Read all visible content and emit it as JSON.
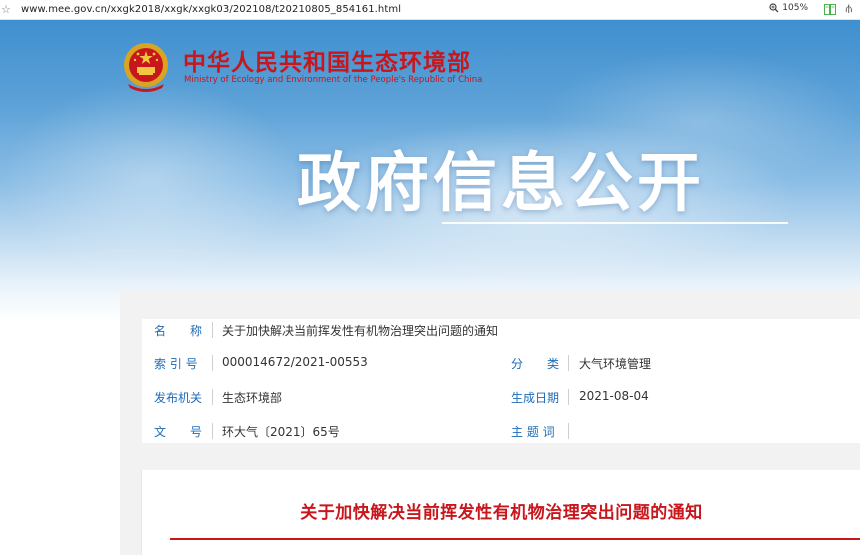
{
  "browser": {
    "url": "www.mee.gov.cn/xxgk2018/xxgk/xxgk03/202108/t20210805_854161.html",
    "zoom": "105%",
    "icons": [
      "bookmark-star-icon",
      "zoom-icon",
      "reader-mode-icon",
      "pin-icon"
    ]
  },
  "site": {
    "title": "中华人民共和国生态环境部",
    "subtitle": "Ministry of Ecology and Environment of the People's Republic of China"
  },
  "hero": {
    "title": "政府信息公开"
  },
  "info": {
    "name_label": "名　　称",
    "name_value": "关于加快解决当前挥发性有机物治理突出问题的通知",
    "index_label": "索 引 号",
    "index_value": "000014672/2021-00553",
    "category_label": "分　　类",
    "category_value": "大气环境管理",
    "issuer_label": "发布机关",
    "issuer_value": "生态环境部",
    "date_label": "生成日期",
    "date_value": "2021-08-04",
    "docno_label": "文　　号",
    "docno_value": "环大气〔2021〕65号",
    "subject_label": "主 题 词",
    "subject_value": ""
  },
  "article": {
    "title": "关于加快解决当前挥发性有机物治理突出问题的通知"
  },
  "colors": {
    "brand_red": "#c8161d",
    "label_blue": "#1e6bb8",
    "sky_blue": "#3f8fcf"
  }
}
